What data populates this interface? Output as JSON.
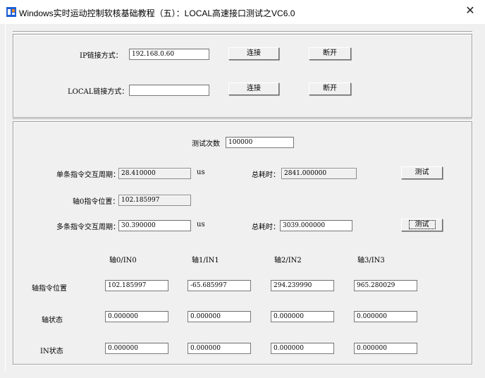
{
  "window": {
    "title": "Windows实时运动控制软核基础教程（五）：LOCAL高速接口测试之VC6.0",
    "close_glyph": "✕"
  },
  "connection": {
    "ip_label": "IP链接方式：",
    "ip_value": "192.168.0.60",
    "local_label": "LOCAL链接方式：",
    "local_value": "",
    "connect_label": "连接",
    "disconnect_label": "断开"
  },
  "test": {
    "count_label": "测试次数",
    "count_value": "100000",
    "single_label": "单条指令交互周期：",
    "single_value": "28.410000",
    "unit": "us",
    "total_label": "总耗时：",
    "single_total": "2841.000000",
    "test_label": "测试",
    "axis0_label": "轴0指令位置：",
    "axis0_value": "102.185997",
    "multi_label": "多条指令交互周期：",
    "multi_value": "30.390000",
    "multi_total": "3039.000000"
  },
  "grid": {
    "columns": [
      "轴0/IN0",
      "轴1/IN1",
      "轴2/IN2",
      "轴3/IN3"
    ],
    "rows": [
      {
        "label": "轴指令位置",
        "values": [
          "102.185997",
          "-65.685997",
          "294.239990",
          "965.280029"
        ]
      },
      {
        "label": "轴状态",
        "values": [
          "0.000000",
          "0.000000",
          "0.000000",
          "0.000000"
        ]
      },
      {
        "label": "IN状态",
        "values": [
          "0.000000",
          "0.000000",
          "0.000000",
          "0.000000"
        ]
      }
    ]
  },
  "colors": {
    "icon_blue": "#1e5fd6",
    "icon_orange": "#f08a1c"
  }
}
